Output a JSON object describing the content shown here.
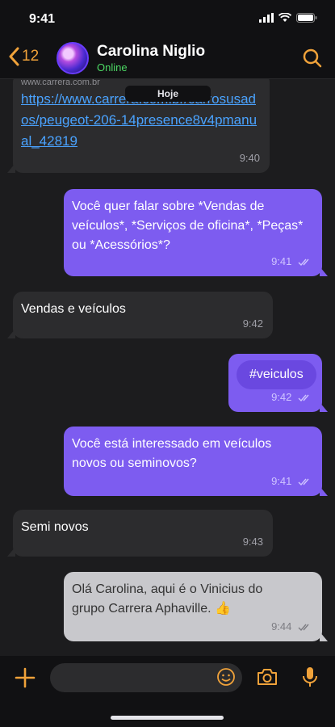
{
  "status_bar": {
    "time": "9:41"
  },
  "header": {
    "back_count": "12",
    "contact_name": "Carolina Niglio",
    "contact_status": "Online"
  },
  "chat": {
    "date_label": "Hoje",
    "messages": [
      {
        "direction": "incoming",
        "type": "link",
        "site": "www.carrera.com.br",
        "text": "https://www.carrera.com.br/carrosusados/peugeot-206-14presence8v4pmanual_42819",
        "time": "9:40"
      },
      {
        "direction": "outgoing",
        "text": "Você quer falar sobre *Vendas de veículos*, *Serviços de oficina*, *Peças* ou *Acessórios*?",
        "time": "9:41"
      },
      {
        "direction": "incoming",
        "text": "Vendas e veículos",
        "time": "9:42"
      },
      {
        "direction": "outgoing",
        "text": "#veiculos",
        "time": "9:42"
      },
      {
        "direction": "outgoing",
        "text": "Você está interessado em veículos novos ou seminovos?",
        "time": "9:41"
      },
      {
        "direction": "incoming",
        "text": "Semi novos",
        "time": "9:43"
      },
      {
        "direction": "outgoing",
        "text": "Olá Carolina, aqui é o Vinicius do grupo Carrera Aphaville. 👍",
        "time": "9:44"
      }
    ]
  },
  "input": {
    "placeholder": ""
  },
  "colors": {
    "accent": "#f0a23a",
    "outgoing_bubble": "#7d5cf0",
    "incoming_bubble": "#2c2c2e",
    "online": "#4cd964"
  }
}
